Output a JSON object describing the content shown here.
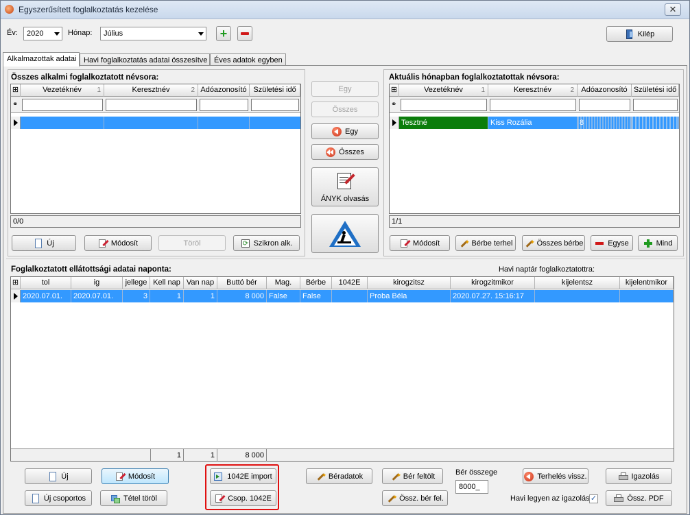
{
  "window": {
    "title": "Egyszerűsített foglalkoztatás kezelése",
    "close_glyph": "✕"
  },
  "toolbar": {
    "year_label": "Év:",
    "year_value": "2020",
    "month_label": "Hónap:",
    "month_value": "Július",
    "add_glyph": "+",
    "remove_glyph": "−",
    "exit_label": "Kilép"
  },
  "tabs": [
    {
      "label": "Alkalmazottak adatai"
    },
    {
      "label": "Havi foglalkoztatás adatai összesítve"
    },
    {
      "label": "Éves adatok egyben"
    }
  ],
  "left": {
    "title": "Összes alkalmi foglalkoztatott névsora:",
    "columns": [
      "Vezetéknév",
      "Keresztnév",
      "Adóazonosító",
      "Születési idő"
    ],
    "sort_marks": [
      "1",
      "2"
    ],
    "status": "0/0",
    "buttons": {
      "new": "Új",
      "edit": "Módosít",
      "delete": "Töröl",
      "sync": "Szikron alk."
    }
  },
  "middle": {
    "one_right": "Egy",
    "all_right": "Összes",
    "one_left": "Egy",
    "all_left": "Összes",
    "anyk": "ÁNYK olvasás"
  },
  "right": {
    "title": "Aktuális hónapban foglalkoztatottak névsora:",
    "columns": [
      "Vezetéknév",
      "Keresztnév",
      "Adóazonosító",
      "Születési idő"
    ],
    "sort_marks": [
      "1",
      "2"
    ],
    "row": {
      "last": "Tesztné",
      "first": "Kiss Rozália",
      "tax": "8",
      "birth": ""
    },
    "status": "1/1",
    "buttons": {
      "edit": "Módosít",
      "lend": "Bérbe terhel",
      "lend_all": "Összes bérbe",
      "one_off": "Egyse",
      "all": "Mind"
    }
  },
  "daily": {
    "title": "Foglalkoztatott ellátottsági adatai naponta:",
    "calendar_label": "Havi naptár foglalkoztatottra:",
    "columns": [
      "tol",
      "ig",
      "jellege",
      "Kell nap",
      "Van nap",
      "Buttó bér",
      "Mag.",
      "Bérbe",
      "1042E",
      "kirogzitsz",
      "kirogzitmikor",
      "kijelentsz",
      "kijelentmikor"
    ],
    "row": [
      "2020.07.01.",
      "2020.07.01.",
      "3",
      "1",
      "1",
      "8 000",
      "False",
      "False",
      "",
      "Proba Béla",
      "2020.07.27. 15:16:17",
      "",
      ""
    ],
    "totals": {
      "kell": "1",
      "van": "1",
      "bruttó": "8 000"
    }
  },
  "bottom": {
    "new": "Új",
    "edit": "Módosít",
    "new_group": "Új csoportos",
    "delete_item": "Tétel töröl",
    "import_1042": "1042E import",
    "group_1042": "Csop. 1042E",
    "wage_data": "Béradatok",
    "wage_upload": "Bér feltölt",
    "sum_wage": "Össz. bér fel.",
    "wage_sum_label": "Bér összege",
    "wage_sum_value": "8000_",
    "undo": "Terhelés vissz.",
    "certificate": "Igazolás",
    "sum_pdf": "Össz. PDF",
    "monthly_cert_label": "Havi legyen az igazolás",
    "monthly_cert_checked": "✓"
  },
  "colors": {
    "selection": "#3399ff",
    "green_row": "#0b7d0b",
    "highlight_box": "#e01010"
  }
}
